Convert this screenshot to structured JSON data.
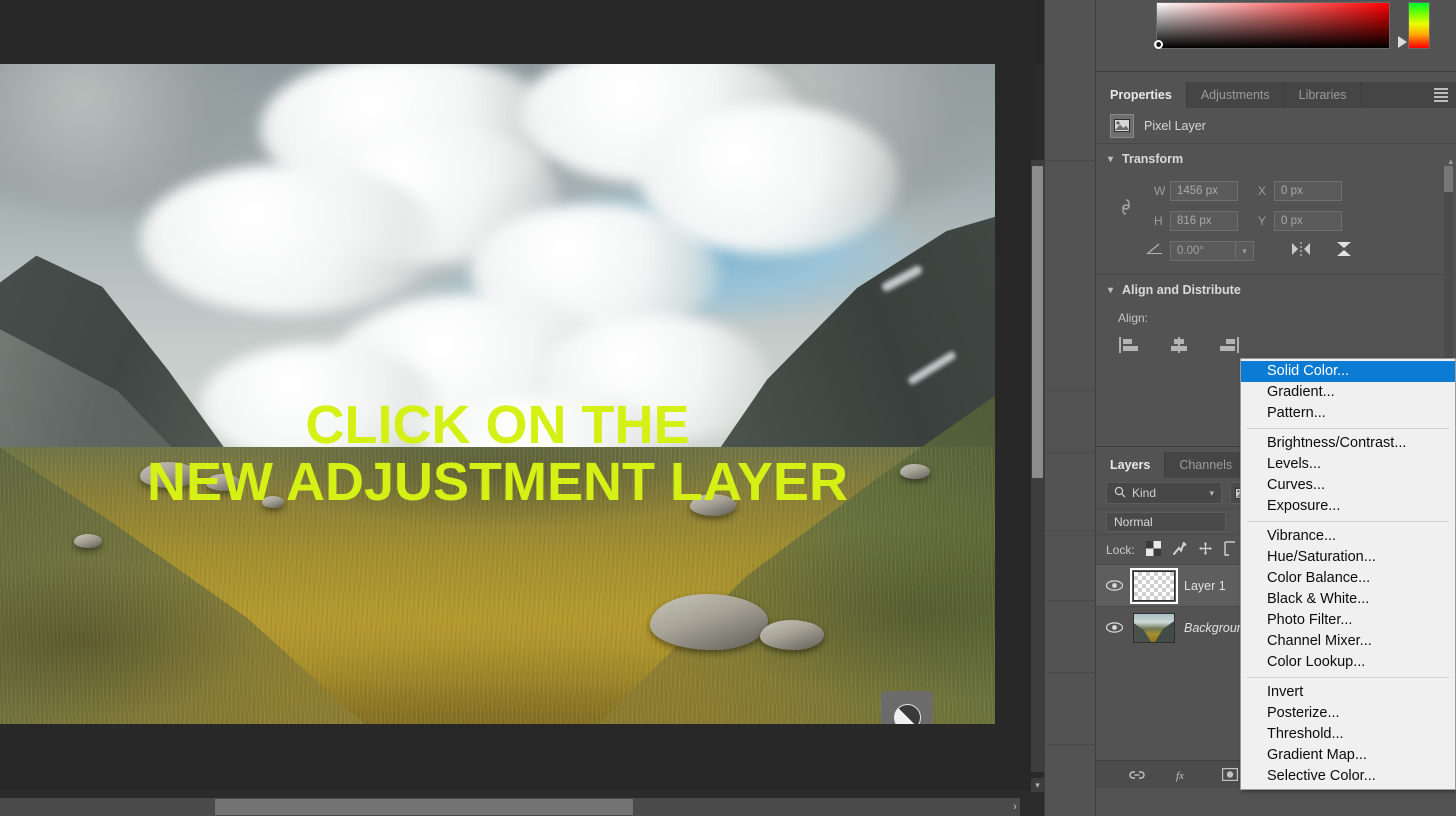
{
  "app": {
    "canvas_bg": "#282828",
    "panel_bg": "#535353",
    "accent_blue": "#0b7bd4",
    "overlay_text_color": "#d4f015"
  },
  "canvas": {
    "overlay_line1": "CLICK ON THE",
    "overlay_line2": "NEW ADJUSTMENT LAYER",
    "callout_icon": "adjustment-layer-icon"
  },
  "color_picker": {
    "icon": "color-picker-panel",
    "sv_label": "saturation-value-square",
    "hue_label": "hue-strip"
  },
  "properties_panel": {
    "tabs": [
      {
        "label": "Properties",
        "active": true
      },
      {
        "label": "Adjustments",
        "active": false
      },
      {
        "label": "Libraries",
        "active": false
      }
    ],
    "menu_icon": "hamburger-icon",
    "layer_kind": "Pixel Layer",
    "transform": {
      "title": "Transform",
      "w_label": "W",
      "w_value": "1456 px",
      "h_label": "H",
      "h_value": "816 px",
      "x_label": "X",
      "x_value": "0 px",
      "y_label": "Y",
      "y_value": "0 px",
      "angle_value": "0.00°",
      "link_icon": "link-icon",
      "flip_horizontal_icon": "flip-horizontal-icon",
      "flip_vertical_icon": "flip-vertical-icon"
    },
    "align": {
      "title": "Align and Distribute",
      "label": "Align:",
      "icons": [
        "align-left-icon",
        "align-center-icon",
        "align-right-icon"
      ]
    }
  },
  "layers_panel": {
    "tabs": [
      {
        "label": "Layers",
        "active": true
      },
      {
        "label": "Channels",
        "active": false
      }
    ],
    "filter": {
      "kind_label": "Kind",
      "search_icon": "search-icon",
      "caret_icon": "chevron-down-icon",
      "pixel_filter_icon": "pixel-filter-icon"
    },
    "blend_mode": "Normal",
    "lock": {
      "label": "Lock:",
      "icons": [
        "lock-transparency-icon",
        "lock-image-icon",
        "lock-position-icon",
        "lock-artboard-icon"
      ]
    },
    "layers": [
      {
        "name": "Layer 1",
        "thumb": "transparent",
        "visible": true,
        "selected": true,
        "italic": false
      },
      {
        "name": "Background",
        "thumb": "photo",
        "visible": true,
        "selected": false,
        "italic": true
      }
    ],
    "footer_icons": [
      "link-layers-icon",
      "layer-style-icon",
      "layer-mask-icon",
      "new-adjustment-layer-icon",
      "new-group-icon",
      "new-layer-icon",
      "delete-layer-icon"
    ]
  },
  "context_menu": {
    "groups": [
      [
        {
          "label": "Solid Color...",
          "highlighted": true
        },
        {
          "label": "Gradient...",
          "highlighted": false
        },
        {
          "label": "Pattern...",
          "highlighted": false
        }
      ],
      [
        {
          "label": "Brightness/Contrast...",
          "highlighted": false
        },
        {
          "label": "Levels...",
          "highlighted": false
        },
        {
          "label": "Curves...",
          "highlighted": false
        },
        {
          "label": "Exposure...",
          "highlighted": false
        }
      ],
      [
        {
          "label": "Vibrance...",
          "highlighted": false
        },
        {
          "label": "Hue/Saturation...",
          "highlighted": false
        },
        {
          "label": "Color Balance...",
          "highlighted": false
        },
        {
          "label": "Black & White...",
          "highlighted": false
        },
        {
          "label": "Photo Filter...",
          "highlighted": false
        },
        {
          "label": "Channel Mixer...",
          "highlighted": false
        },
        {
          "label": "Color Lookup...",
          "highlighted": false
        }
      ],
      [
        {
          "label": "Invert",
          "highlighted": false
        },
        {
          "label": "Posterize...",
          "highlighted": false
        },
        {
          "label": "Threshold...",
          "highlighted": false
        },
        {
          "label": "Gradient Map...",
          "highlighted": false
        },
        {
          "label": "Selective Color...",
          "highlighted": false
        }
      ]
    ]
  },
  "scrollbars": {
    "vertical_icon": "vertical-scrollbar",
    "horizontal_icon": "horizontal-scrollbar"
  }
}
